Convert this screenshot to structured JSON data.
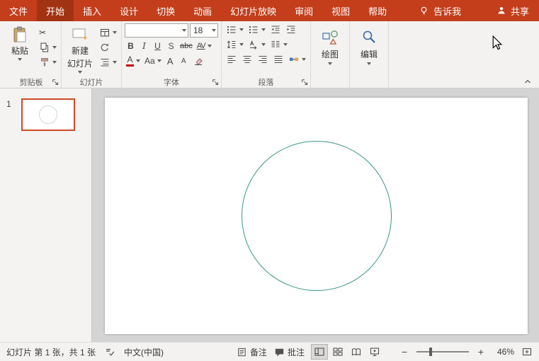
{
  "tabs": [
    {
      "label": "文件"
    },
    {
      "label": "开始",
      "active": true
    },
    {
      "label": "插入"
    },
    {
      "label": "设计"
    },
    {
      "label": "切换"
    },
    {
      "label": "动画"
    },
    {
      "label": "幻灯片放映"
    },
    {
      "label": "审阅"
    },
    {
      "label": "视图"
    },
    {
      "label": "帮助"
    }
  ],
  "titlebar": {
    "tell_me_label": "告诉我",
    "share_label": "共享"
  },
  "ribbon": {
    "clipboard": {
      "group_label": "剪贴板",
      "paste_label": "粘贴"
    },
    "slides": {
      "group_label": "幻灯片",
      "new_slide_line1": "新建",
      "new_slide_line2": "幻灯片"
    },
    "font": {
      "group_label": "字体",
      "font_name_value": "",
      "font_size_value": "18",
      "bold_label": "B",
      "italic_label": "I",
      "underline_label": "U",
      "shadow_label": "S",
      "strikethrough_label": "abc",
      "char_spacing_label": "AV",
      "font_color_label": "A",
      "change_case_label": "Aa",
      "grow_font_label": "A",
      "shrink_font_label": "A"
    },
    "paragraph": {
      "group_label": "段落"
    },
    "drawing": {
      "button_label": "绘图"
    },
    "editing": {
      "button_label": "编辑"
    }
  },
  "slides_panel": {
    "slide_number": "1"
  },
  "canvas": {
    "shape": "circle-outline",
    "shape_outline_color": "#3A9688"
  },
  "statusbar": {
    "slide_info": "幻灯片 第 1 张，共 1 张",
    "language": "中文(中国)",
    "notes_label": "备注",
    "comments_label": "批注",
    "zoom_value": "46%",
    "zoom_out_glyph": "−",
    "zoom_in_glyph": "+"
  },
  "icons": {
    "cut_glyph": "✂"
  },
  "colors": {
    "ribbon_red": "#C43E1C",
    "active_tab_red": "#A23312",
    "slide_selection_border": "#D04A26",
    "shape_outline": "#3A9688"
  }
}
